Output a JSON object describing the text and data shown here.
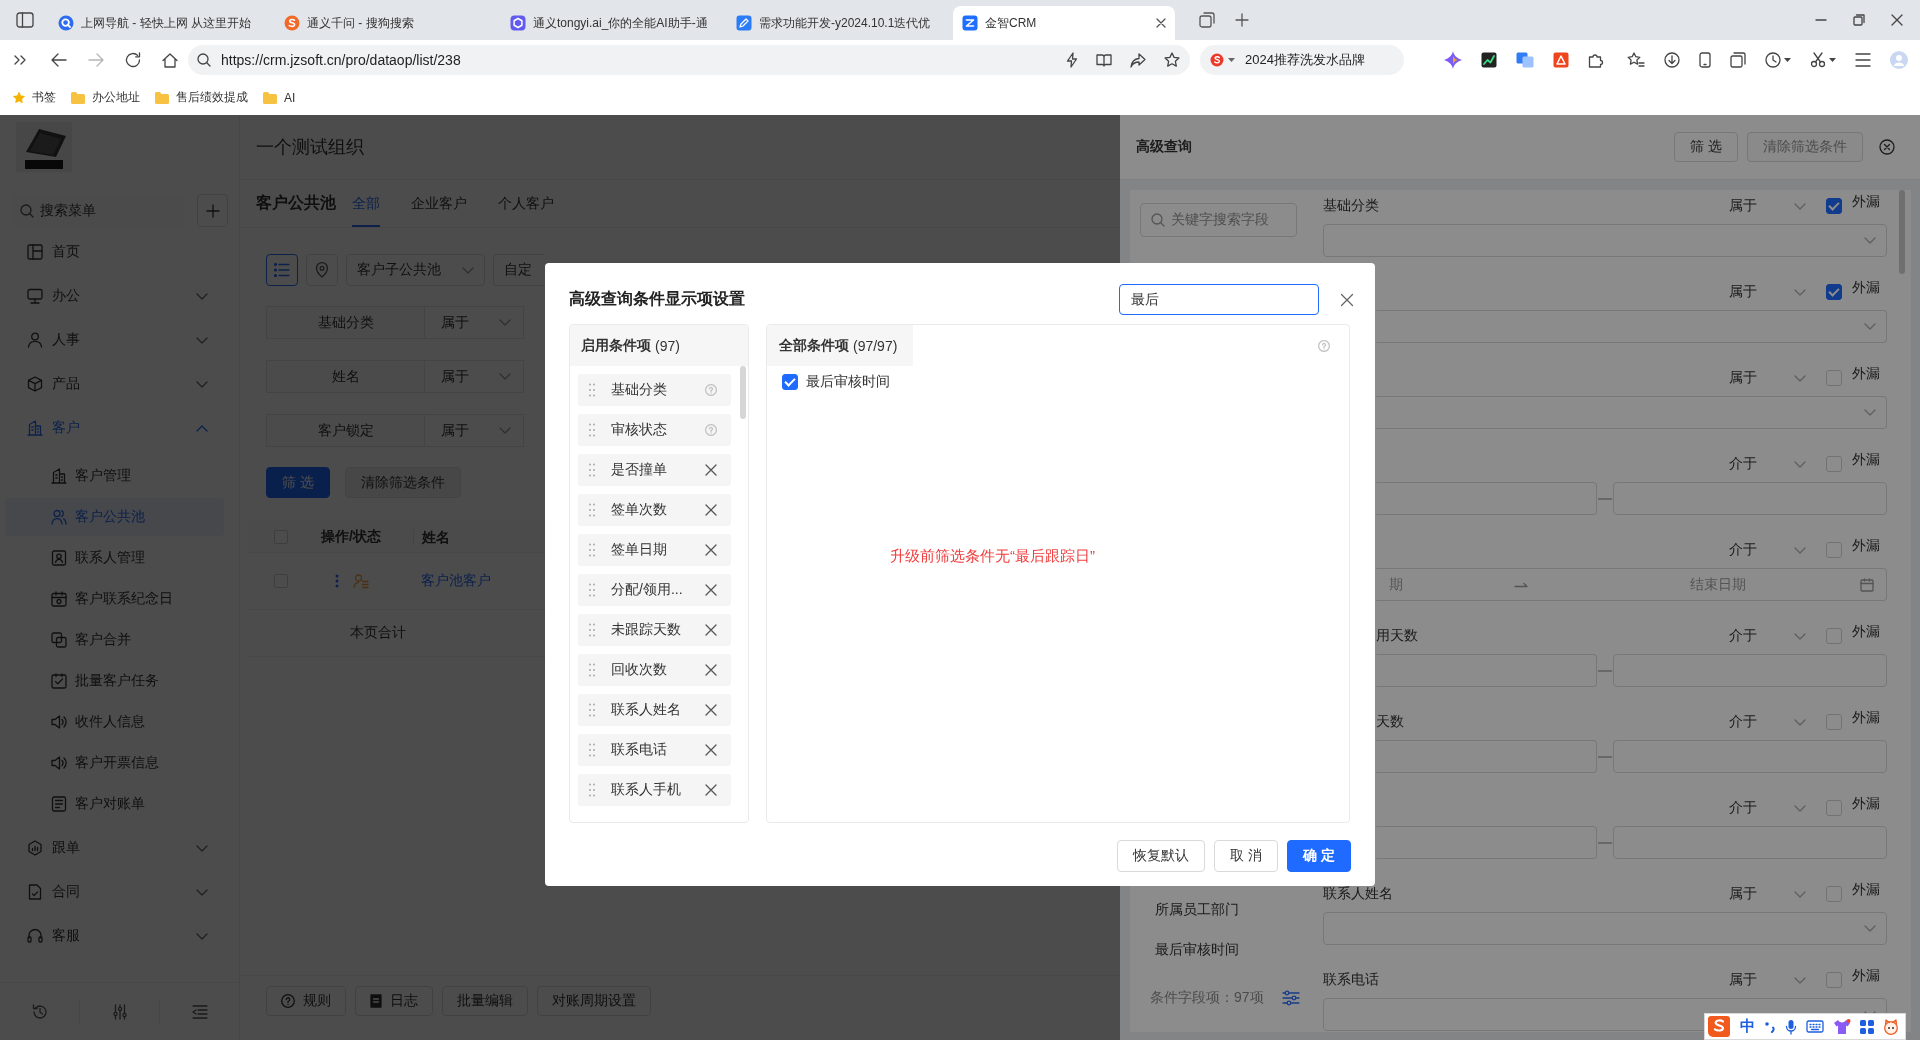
{
  "browser": {
    "tabs": [
      {
        "title": "上网导航 - 轻快上网 从这里开始",
        "selected": false
      },
      {
        "title": "通义千问 - 搜狗搜索",
        "selected": false
      },
      {
        "title": "通义tongyi.ai_你的全能AI助手-通",
        "selected": false
      },
      {
        "title": "需求功能开发-y2024.10.1迭代优",
        "selected": false
      },
      {
        "title": "金智CRM",
        "selected": true
      }
    ],
    "url": "https://crm.jzsoft.cn/pro/dataop/list/238",
    "search_hint": "2024推荐洗发水品牌",
    "bookmarks": [
      {
        "label": "书签",
        "kind": "star"
      },
      {
        "label": "办公地址",
        "kind": "folder"
      },
      {
        "label": "售后绩效提成",
        "kind": "folder"
      },
      {
        "label": "AI",
        "kind": "folder"
      }
    ]
  },
  "sidebar": {
    "search": {
      "placeholder": "搜索菜单"
    },
    "items": [
      {
        "label": "首页",
        "selected": false
      },
      {
        "label": "办公",
        "selected": false,
        "expanded": false
      },
      {
        "label": "人事",
        "selected": false,
        "expanded": false
      },
      {
        "label": "产品",
        "selected": false,
        "expanded": false
      },
      {
        "label": "客户",
        "selected": false,
        "expanded": true,
        "children": [
          {
            "label": "客户管理",
            "selected": false
          },
          {
            "label": "客户公共池",
            "selected": true
          },
          {
            "label": "联系人管理",
            "selected": false
          },
          {
            "label": "客户联系纪念日",
            "selected": false
          },
          {
            "label": "客户合并",
            "selected": false
          },
          {
            "label": "批量客户任务",
            "selected": false
          },
          {
            "label": "收件人信息",
            "selected": false
          },
          {
            "label": "客户开票信息",
            "selected": false
          },
          {
            "label": "客户对账单",
            "selected": false
          }
        ]
      },
      {
        "label": "跟单",
        "selected": false,
        "expanded": false
      },
      {
        "label": "合同",
        "selected": false,
        "expanded": false
      },
      {
        "label": "客服",
        "selected": false,
        "expanded": false
      }
    ]
  },
  "main": {
    "org": "一个测试组织",
    "title": "客户公共池",
    "tabs": [
      {
        "label": "全部",
        "selected": true
      },
      {
        "label": "企业客户",
        "selected": false
      },
      {
        "label": "个人客户",
        "selected": false
      }
    ],
    "view_buttons": [
      {
        "kind": "list",
        "selected": true
      },
      {
        "kind": "map",
        "selected": false
      }
    ],
    "dropdowns": [
      {
        "placeholder": "客户子公共池"
      },
      {
        "placeholder": "自定"
      }
    ],
    "filters": [
      {
        "field": "基础分类",
        "operator": "属于"
      },
      {
        "field": "姓名",
        "operator": "属于"
      },
      {
        "field": "客户锁定",
        "operator": "属于"
      }
    ],
    "filter_button": "筛 选",
    "clear_button": {
      "label": "清除筛选条件",
      "disabled": true
    },
    "table": {
      "all_checked": false,
      "columns": [
        "操作/状态",
        "姓名"
      ],
      "rows": [
        {
          "checked": false,
          "name": "客户池客户"
        }
      ],
      "summary": "本页合计"
    },
    "footer_buttons": [
      {
        "label": "规则",
        "kind": "help"
      },
      {
        "label": "日志",
        "kind": "log"
      },
      {
        "label": "批量编辑",
        "kind": "plain"
      },
      {
        "label": "对账周期设置",
        "kind": "plain"
      }
    ]
  },
  "drawer": {
    "title": "高级查询",
    "filter_button": "筛 选",
    "clear_button": {
      "label": "清除筛选条件",
      "disabled": true
    },
    "field_search": {
      "placeholder": "关键字搜索字段"
    },
    "fields": [
      "所属员工部门",
      "最后审核时间"
    ],
    "field_count": "条件字段项：97项",
    "conditions": [
      {
        "label": "基础分类",
        "operator": "属于",
        "option": "外漏",
        "checked": true,
        "kind": "select"
      },
      {
        "operator": "属于",
        "option": "外漏",
        "checked": true,
        "kind": "select"
      },
      {
        "operator": "属于",
        "option": "外漏",
        "checked": false,
        "kind": "select"
      },
      {
        "operator": "介于",
        "option": "外漏",
        "checked": false,
        "kind": "range"
      },
      {
        "operator": "介于",
        "option": "外漏",
        "checked": false,
        "kind": "date_range",
        "start_placeholder": "期",
        "end_placeholder": "结束日期"
      },
      {
        "label": "用天数",
        "operator": "介于",
        "option": "外漏",
        "checked": false,
        "kind": "range"
      },
      {
        "label": "天数",
        "operator": "介于",
        "option": "外漏",
        "checked": false,
        "kind": "range"
      },
      {
        "operator": "介于",
        "option": "外漏",
        "checked": false,
        "kind": "range"
      },
      {
        "label": "联系人姓名",
        "operator": "属于",
        "option": "外漏",
        "checked": false,
        "kind": "select"
      },
      {
        "label": "联系电话",
        "operator": "属于",
        "option": "外漏",
        "checked": false,
        "kind": "select"
      }
    ]
  },
  "modal": {
    "title": "高级查询条件显示项设置",
    "search": {
      "value": "最后"
    },
    "enabled": {
      "title": "**启用条件项** (97)",
      "items": [
        {
          "label": "基础分类",
          "kind": "locked"
        },
        {
          "label": "审核状态",
          "kind": "locked"
        },
        {
          "label": "是否撞单",
          "kind": "removable"
        },
        {
          "label": "签单次数",
          "kind": "removable"
        },
        {
          "label": "签单日期",
          "kind": "removable"
        },
        {
          "label": "分配/领用...",
          "kind": "removable"
        },
        {
          "label": "未跟踪天数",
          "kind": "removable"
        },
        {
          "label": "回收次数",
          "kind": "removable"
        },
        {
          "label": "联系人姓名",
          "kind": "removable"
        },
        {
          "label": "联系电话",
          "kind": "removable"
        },
        {
          "label": "联系人手机",
          "kind": "removable"
        }
      ]
    },
    "all": {
      "title": "**全部条件项** (97/97)",
      "items": [
        {
          "label": "最后审核时间",
          "checked": true
        }
      ]
    },
    "note": "升级前筛选条件无“最后跟踪日”",
    "buttons": [
      {
        "label": "恢复默认",
        "kind": "default"
      },
      {
        "label": "取 消",
        "kind": "default"
      },
      {
        "label": "确 定",
        "kind": "primary"
      }
    ]
  },
  "ime": {
    "mode": "中"
  }
}
